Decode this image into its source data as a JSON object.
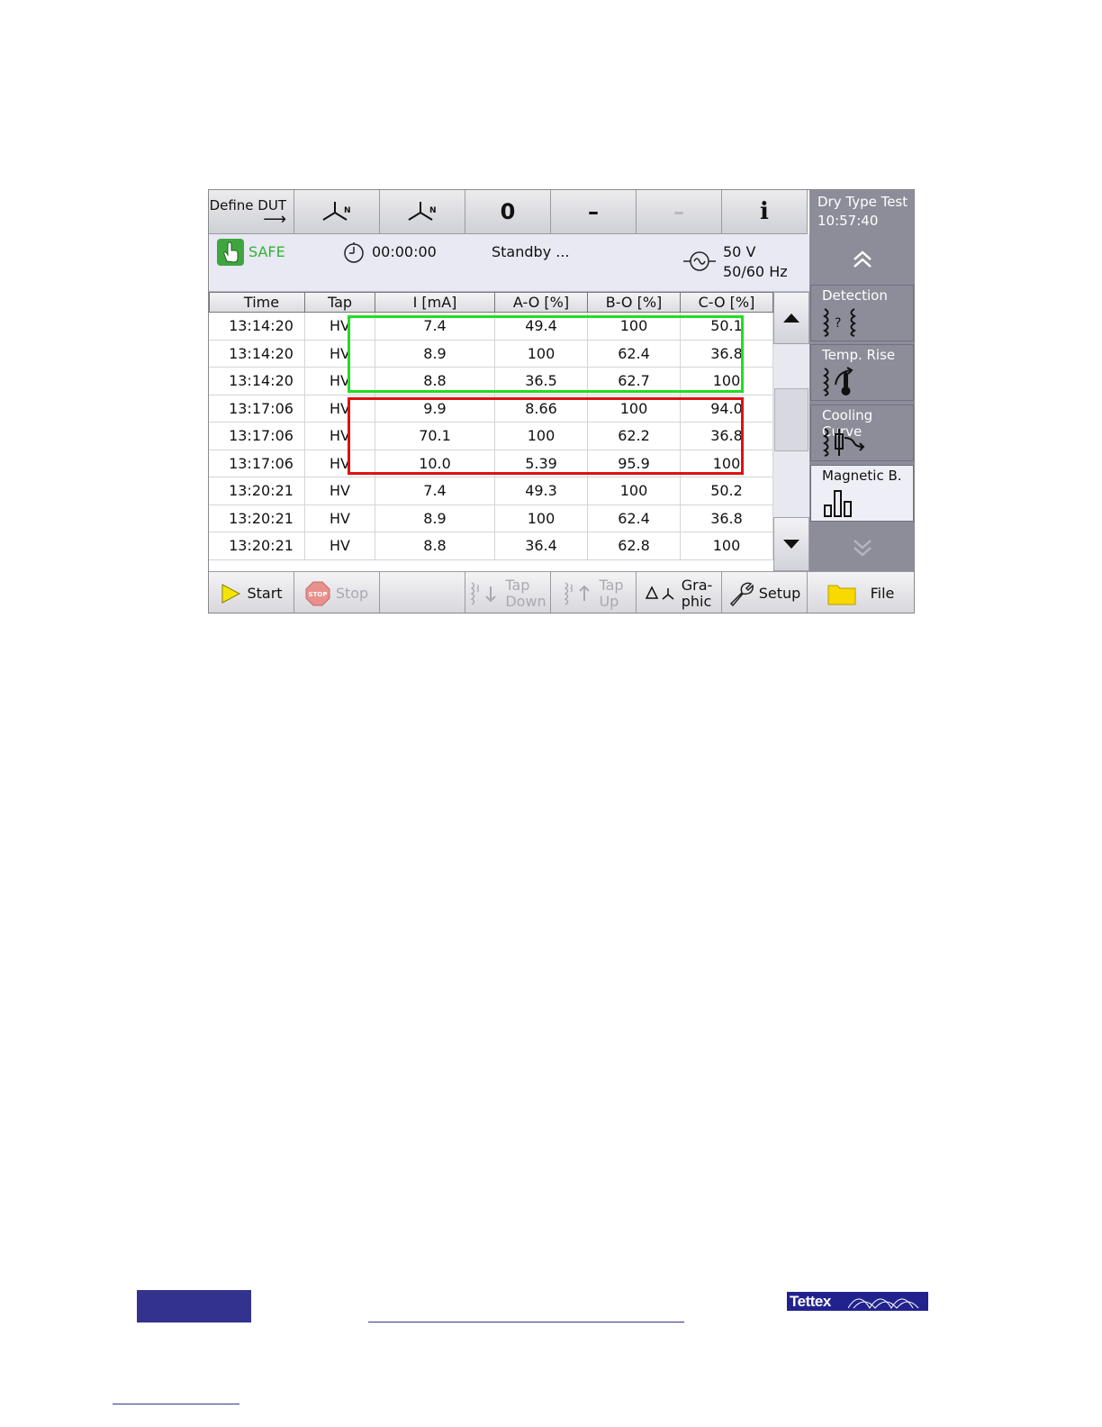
{
  "toolbar": {
    "define_dut_label": "Define DUT",
    "define_dut_arrow": "⟶",
    "vector1_label": "N",
    "vector2_label": "N",
    "zero_label": "0",
    "dash1_label": "–",
    "dash2_label": "–",
    "info_label": "i"
  },
  "title": {
    "test_name": "Dry Type Test",
    "clock": "10:57:40"
  },
  "status": {
    "safe_label": "SAFE",
    "timer": "00:00:00",
    "state": "Standby ...",
    "voltage": "50 V",
    "frequency": "50/60 Hz"
  },
  "table": {
    "headers": [
      "Time",
      "Tap",
      "I [mA]",
      "A-O [%]",
      "B-O [%]",
      "C-O [%]"
    ],
    "rows": [
      [
        "13:14:20",
        "HV",
        "7.4",
        "49.4",
        "100",
        "50.1"
      ],
      [
        "13:14:20",
        "HV",
        "8.9",
        "100",
        "62.4",
        "36.8"
      ],
      [
        "13:14:20",
        "HV",
        "8.8",
        "36.5",
        "62.7",
        "100"
      ],
      [
        "13:17:06",
        "HV",
        "9.9",
        "8.66",
        "100",
        "94.0"
      ],
      [
        "13:17:06",
        "HV",
        "70.1",
        "100",
        "62.2",
        "36.8"
      ],
      [
        "13:17:06",
        "HV",
        "10.0",
        "5.39",
        "95.9",
        "100"
      ],
      [
        "13:20:21",
        "HV",
        "7.4",
        "49.3",
        "100",
        "50.2"
      ],
      [
        "13:20:21",
        "HV",
        "8.9",
        "100",
        "62.4",
        "36.8"
      ],
      [
        "13:20:21",
        "HV",
        "8.8",
        "36.4",
        "62.8",
        "100"
      ]
    ]
  },
  "sidenav": {
    "items": [
      {
        "label": "Detection",
        "icon": "detection-icon"
      },
      {
        "label": "Temp. Rise",
        "icon": "thermometer-icon"
      },
      {
        "label": "Cooling Curve",
        "icon": "cooling-curve-icon"
      },
      {
        "label": "Magnetic B.",
        "icon": "bar-chart-icon"
      }
    ],
    "active_index": 3
  },
  "bottombar": {
    "start_label": "Start",
    "stop_label": "Stop",
    "stop_icon_text": "STOP",
    "tap_down_line1": "Tap",
    "tap_down_line2": "Down",
    "tap_up_line1": "Tap",
    "tap_up_line2": "Up",
    "graphic_line1": "Gra-",
    "graphic_line2": "phic",
    "setup_label": "Setup",
    "file_label": "File"
  },
  "footer": {
    "logo_text": "Tettex"
  },
  "colors": {
    "accent_panel": "#8c8d99",
    "safe_green": "#2fb52f",
    "highlight_green": "#22dd22",
    "highlight_red": "#dd1111",
    "brand_blue": "#33338f"
  }
}
